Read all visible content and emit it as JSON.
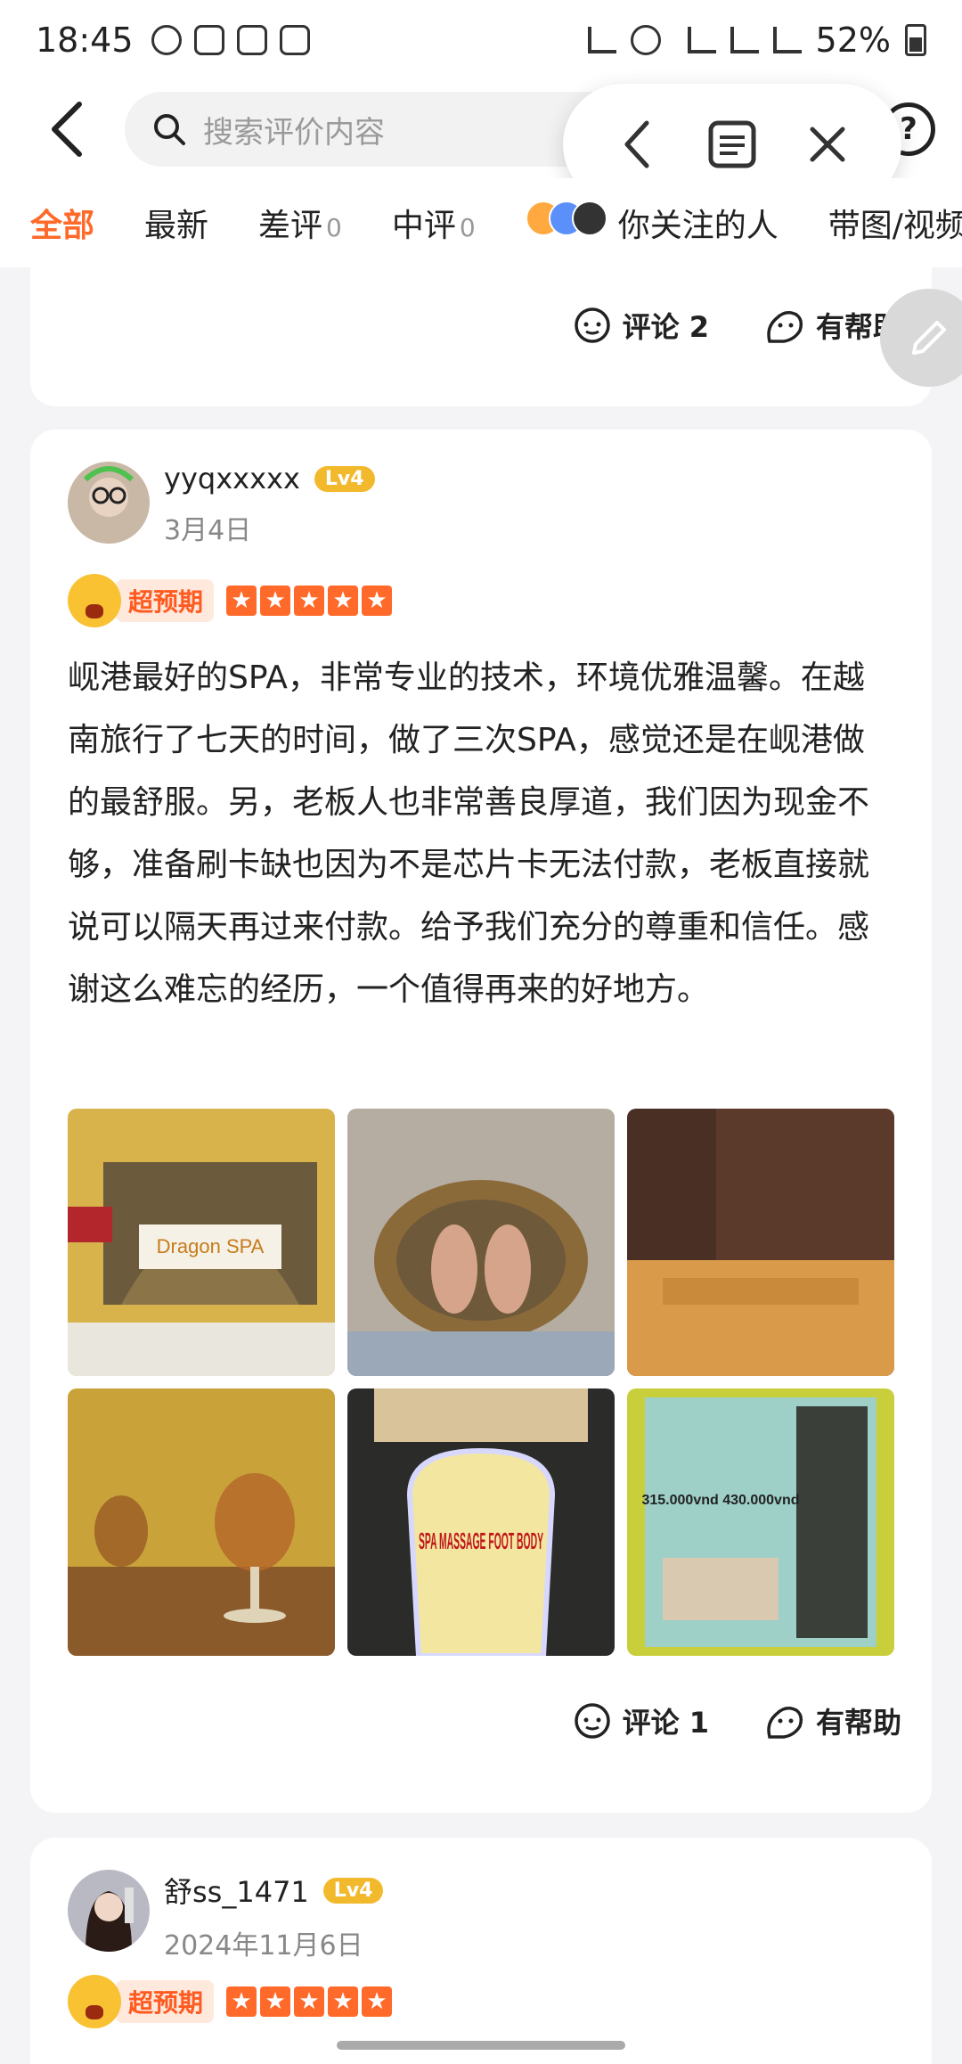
{
  "status_bar": {
    "time": "18:45",
    "battery": "52%"
  },
  "search": {
    "placeholder": "搜索评价内容"
  },
  "tabs": [
    {
      "label": "全部",
      "count": ""
    },
    {
      "label": "最新",
      "count": ""
    },
    {
      "label": "差评",
      "count": "0"
    },
    {
      "label": "中评",
      "count": "0"
    },
    {
      "label": "你关注的人",
      "count": ""
    },
    {
      "label": "带图/视频",
      "count": ""
    }
  ],
  "prev_card": {
    "comment_label": "评论 2",
    "helpful_label": "有帮助"
  },
  "review": {
    "username": "yyqxxxxx",
    "level": "Lv4",
    "date": "3月4日",
    "rating_label": "超预期",
    "stars": 5,
    "text": "岘港最好的SPA，非常专业的技术，环境优雅温馨。在越南旅行了七天的时间，做了三次SPA，感觉还是在岘港做的最舒服。另，老板人也非常善良厚道，我们因为现金不够，准备刷卡缺也因为不是芯片卡无法付款，老板直接就说可以隔天再过来付款。给予我们充分的尊重和信任。感谢这么难忘的经历，一个值得再来的好地方。",
    "comment_label": "评论 1",
    "helpful_label": "有帮助",
    "photos": [
      {
        "caption": "Dragon SPA"
      },
      {
        "caption": ""
      },
      {
        "caption": ""
      },
      {
        "caption": ""
      },
      {
        "caption": "SPA MASSAGE FOOT BODY"
      },
      {
        "caption": "315.000vnd 430.000vnd"
      }
    ]
  },
  "next_review": {
    "username": "舒ss_1471",
    "level": "Lv4",
    "date": "2024年11月6日",
    "rating_label": "超预期",
    "stars": 5
  },
  "colors": {
    "accent": "#ff6a2a",
    "level_badge": "#f3b92c"
  }
}
